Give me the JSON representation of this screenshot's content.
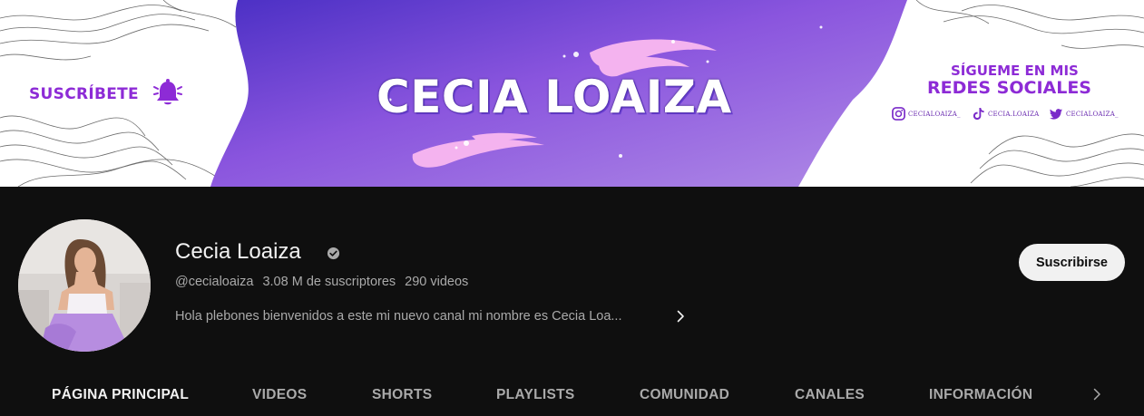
{
  "banner": {
    "title": "CECIA LOAIZA",
    "subscribe_promo": "SUSCRÍBETE",
    "follow_line1": "SÍGUEME EN MIS",
    "follow_line2": "REDES SOCIALES",
    "socials": [
      {
        "network": "instagram-icon",
        "handle": "CECIALOAIZA_"
      },
      {
        "network": "tiktok-icon",
        "handle": "CECIA.LOAIZA"
      },
      {
        "network": "twitter-icon",
        "handle": "CECIALOAIZA_"
      }
    ],
    "colors": {
      "purple": "#7b3fe0",
      "accent_text": "#8d2bd6",
      "pink": "#f4b3ef"
    }
  },
  "channel": {
    "name": "Cecia Loaiza",
    "handle": "@cecialoaiza",
    "subscribers": "3.08 M de suscriptores",
    "videos": "290 videos",
    "description": "Hola plebones bienvenidos a este mi nuevo canal mi nombre es Cecia Loa...",
    "subscribe_label": "Suscribirse"
  },
  "tabs": [
    {
      "label": "PÁGINA PRINCIPAL",
      "active": true
    },
    {
      "label": "VIDEOS",
      "active": false
    },
    {
      "label": "SHORTS",
      "active": false
    },
    {
      "label": "PLAYLISTS",
      "active": false
    },
    {
      "label": "COMUNIDAD",
      "active": false
    },
    {
      "label": "CANALES",
      "active": false
    },
    {
      "label": "INFORMACIÓN",
      "active": false
    }
  ]
}
